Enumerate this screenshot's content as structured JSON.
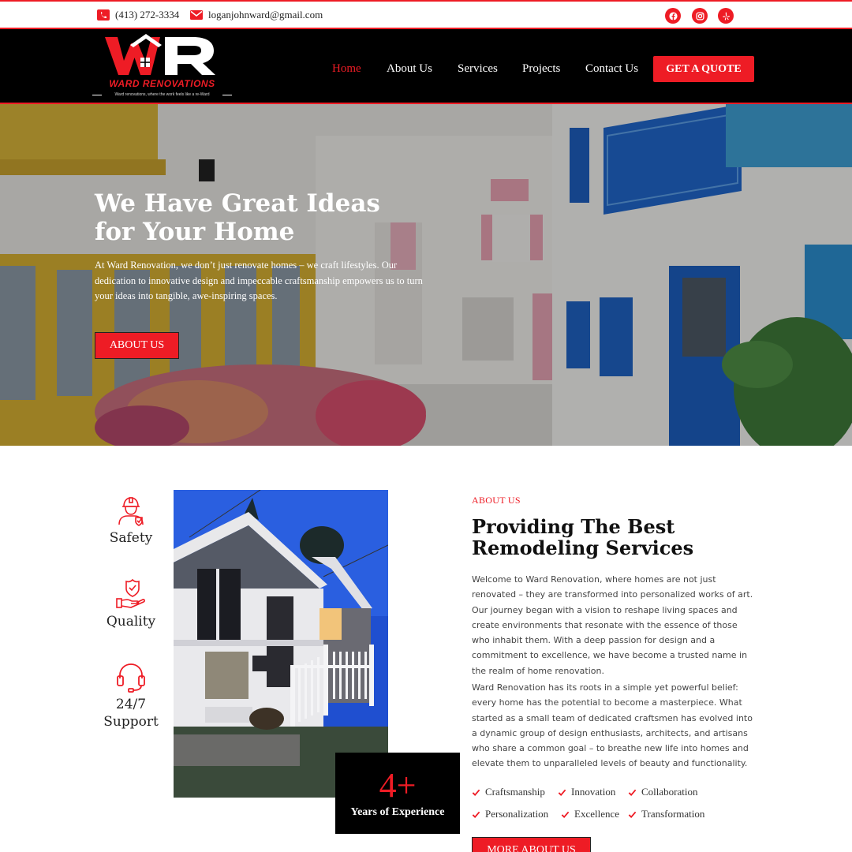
{
  "topbar": {
    "phone": "(413) 272-3334",
    "email": "loganjohnward@gmail.com",
    "social": [
      "facebook-icon",
      "instagram-icon",
      "yelp-icon"
    ]
  },
  "logo": {
    "monogram": "WR",
    "brand": "WARD RENOVATIONS",
    "tagline": "Ward renovations, where the work feels like a re-Ward"
  },
  "nav": {
    "items": [
      {
        "label": "Home",
        "active": true
      },
      {
        "label": "About Us",
        "active": false
      },
      {
        "label": "Services",
        "active": false
      },
      {
        "label": "Projects",
        "active": false
      },
      {
        "label": "Contact Us",
        "active": false
      }
    ],
    "cta": "GET A QUOTE"
  },
  "hero": {
    "title": "We Have Great Ideas for Your Home",
    "text": "At Ward Renovation, we don’t just renovate homes – we craft lifestyles. Our dedication to innovative design and impeccable craftsmanship empowers us to turn your ideas into tangible, awe-inspiring spaces.",
    "button": "ABOUT US"
  },
  "features": [
    {
      "icon": "worker-safety-icon",
      "label": "Safety"
    },
    {
      "icon": "quality-hand-shield-icon",
      "label": "Quality"
    },
    {
      "icon": "headset-support-icon",
      "label": "24/7 Support"
    }
  ],
  "experience": {
    "number": "4+",
    "label": "Years of Experience"
  },
  "about": {
    "eyebrow": "ABOUT US",
    "title": "Providing The Best Remodeling Services",
    "para1": "Welcome to Ward Renovation, where homes are not just renovated – they are transformed into personalized works of art. Our journey began with a vision to reshape living spaces and create environments that resonate with the essence of those who inhabit them. With a deep passion for design and a commitment to excellence, we have become a trusted name in the realm of home renovation.",
    "para2": "Ward Renovation has its roots in a simple yet powerful belief: every home has the potential to become a masterpiece. What started as a small team of dedicated craftsmen has evolved into a dynamic group of design enthusiasts, architects, and artisans who share a common goal – to breathe new life into homes and elevate them to unparalleled levels of beauty and functionality.",
    "values": [
      "Craftsmanship",
      "Innovation",
      "Collaboration",
      "Personalization",
      "Excellence",
      "Transformation"
    ],
    "button": "MORE ABOUT US"
  },
  "colors": {
    "accent": "#ee1c25",
    "dark": "#000000",
    "text": "#222222"
  }
}
